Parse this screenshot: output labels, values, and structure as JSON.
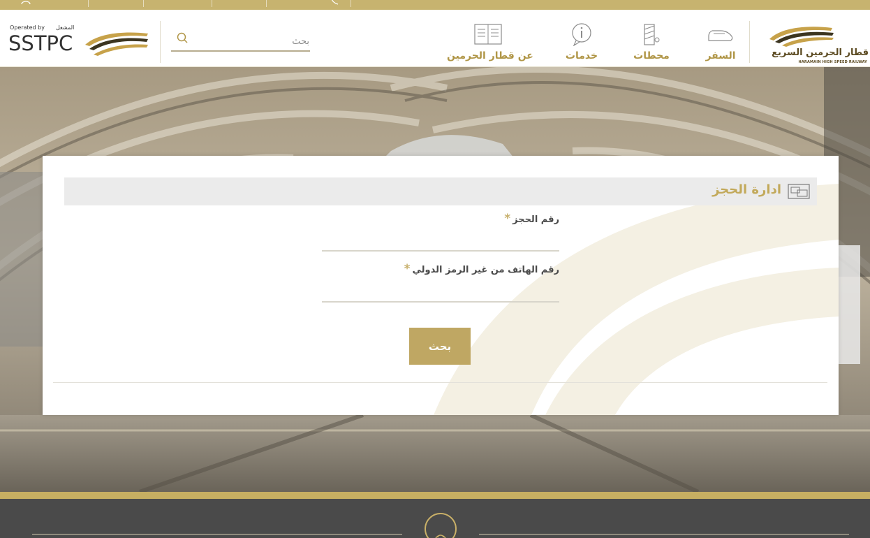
{
  "topbar": {
    "items": [
      "",
      "",
      "",
      ""
    ]
  },
  "header": {
    "brand": {
      "name_ar": "قطار الحرمين السريع",
      "name_en": "HARAMAIN HIGH SPEED RAILWAY"
    },
    "nav": [
      {
        "label": "السفر",
        "icon": "train-icon"
      },
      {
        "label": "محطات",
        "icon": "station-icon"
      },
      {
        "label": "خدمات",
        "icon": "info-icon"
      },
      {
        "label": "عن قطار الحرمين",
        "icon": "book-icon"
      }
    ],
    "search": {
      "placeholder": "بحث"
    },
    "operator": {
      "by_label": "Operated by",
      "by_label_ar": "المشغل",
      "name": "SSTPC"
    }
  },
  "booking": {
    "title": "ادارة الحجز",
    "fields": [
      {
        "label": "رقم الحجز",
        "required_mark": "*",
        "value": ""
      },
      {
        "label": "رقم الهاتف من غير الرمز الدولي",
        "required_mark": "*",
        "value": ""
      }
    ],
    "submit_label": "بحث"
  },
  "colors": {
    "gold": "#bfa763",
    "gold_text": "#b09647",
    "header_bg": "#ffffff",
    "footer_bg": "#4a4a4a"
  }
}
